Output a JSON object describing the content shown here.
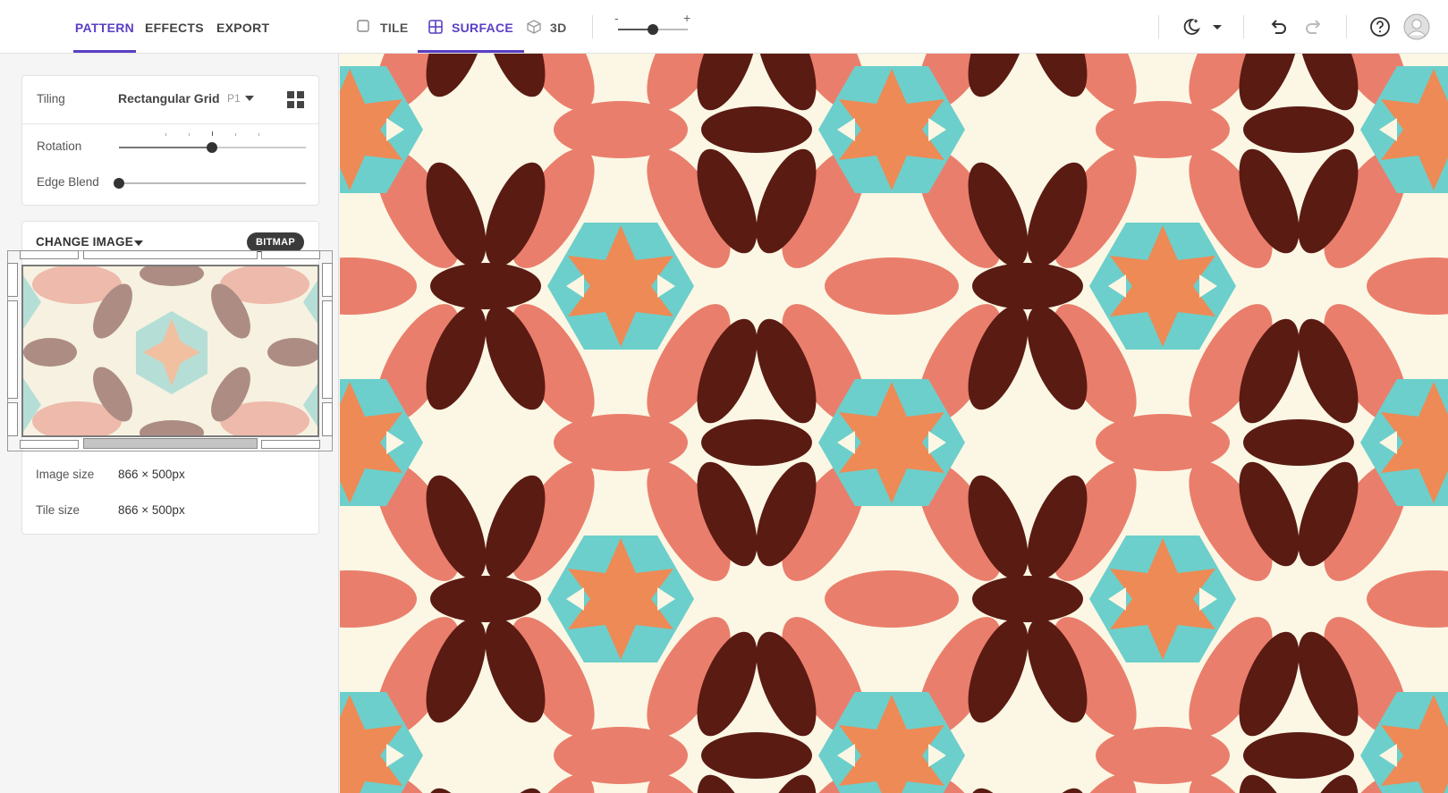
{
  "sidebar": {
    "tabs": [
      {
        "label": "PATTERN",
        "active": true
      },
      {
        "label": "EFFECTS",
        "active": false
      },
      {
        "label": "EXPORT",
        "active": false
      }
    ],
    "tiling": {
      "label": "Tiling",
      "value": "Rectangular Grid",
      "symmetry": "P1"
    },
    "rotation": {
      "label": "Rotation",
      "value_fraction": 0.5
    },
    "edge_blend": {
      "label": "Edge Blend",
      "value_fraction": 0.0
    },
    "change_image_label": "CHANGE IMAGE",
    "bitmap_badge": "BITMAP",
    "info": {
      "image_size_label": "Image size",
      "image_size_value": "866 × 500px",
      "tile_size_label": "Tile size",
      "tile_size_value": "866 × 500px"
    }
  },
  "topbar": {
    "view_tabs": [
      {
        "label": "TILE",
        "icon": "square-outline-icon",
        "active": false
      },
      {
        "label": "SURFACE",
        "icon": "grid-quad-icon",
        "active": true
      },
      {
        "label": "3D",
        "icon": "cube-icon",
        "active": false
      }
    ],
    "zoom": {
      "minus": "-",
      "plus": "+",
      "value_fraction": 0.5
    },
    "icons": [
      "theme-moon-icon",
      "chevron-down-icon",
      "undo-icon",
      "redo-icon",
      "help-icon",
      "user-avatar-icon"
    ]
  },
  "colors": {
    "accent": "#5b3fc4",
    "cream": "#fbf7e4",
    "teal": "#6ccfcb",
    "orange": "#ee8a55",
    "salmon": "#ea7e6c",
    "maroon": "#5a1b13"
  }
}
